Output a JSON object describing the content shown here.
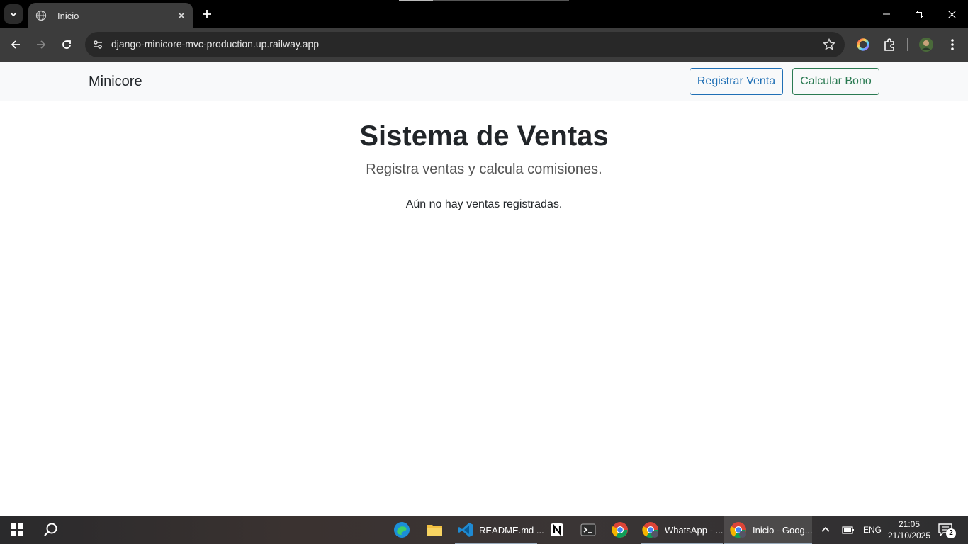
{
  "browser": {
    "tab_title": "Inicio",
    "url": "django-minicore-mvc-production.up.railway.app"
  },
  "navbar": {
    "brand": "Minicore",
    "register_sale_label": "Registrar Venta",
    "calc_bonus_label": "Calcular Bono"
  },
  "main": {
    "title": "Sistema de Ventas",
    "subtitle": "Registra ventas y calcula comisiones.",
    "empty_message": "Aún no hay ventas registradas."
  },
  "taskbar": {
    "vscode_label": "README.md ...",
    "whatsapp_label": "WhatsApp - ...",
    "chrome_active_label": "Inicio - Goog...",
    "language": "ENG",
    "time": "21:05",
    "date": "21/10/2025",
    "notification_count": "2"
  },
  "colors": {
    "primary_outline": "#1f6fb5",
    "success_outline": "#2a7a52",
    "navbar_bg": "#f8f9fa",
    "chrome_dark": "#3c3c3c"
  }
}
